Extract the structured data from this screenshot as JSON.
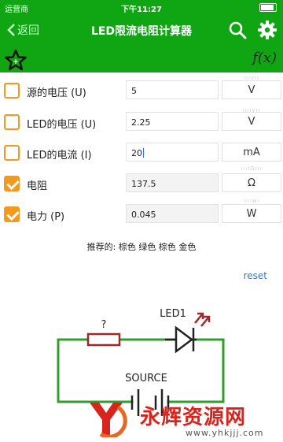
{
  "status_bar": {
    "carrier": "运营商",
    "time": "下午11:27"
  },
  "nav": {
    "back_label": "返回",
    "title": "LED限流电阻计算器"
  },
  "toolbar": {
    "fx_label": "f(x)"
  },
  "rows": [
    {
      "label": "源的电压 (U)",
      "value": "5",
      "unit": "V",
      "checked": false,
      "readonly": false
    },
    {
      "label": "LED的电压 (U)",
      "value": "2.25",
      "unit": "V",
      "checked": false,
      "readonly": false
    },
    {
      "label": "LED的电流 (I)",
      "value": "20",
      "unit": "mA",
      "checked": false,
      "readonly": false
    },
    {
      "label": "电阻",
      "value": "137.5",
      "unit": "Ω",
      "checked": true,
      "readonly": true
    },
    {
      "label": "电力 (P)",
      "value": "0.045",
      "unit": "W",
      "checked": true,
      "readonly": true
    }
  ],
  "recommend": "推荐的: 棕色 绿色 棕色 金色",
  "reset_label": "reset",
  "circuit": {
    "resistor_label": "?",
    "led_label": "LED1",
    "source_label": "SOURCE"
  },
  "colors": {
    "brand_green": "#0fa513",
    "checkbox_orange": "#f39a1e",
    "link_blue": "#2a7ad6",
    "wire_green": "#2ea02a",
    "resistor_red": "#a0282a"
  },
  "watermark": {
    "text": "永辉资源网",
    "url": "www.yhkjjj.com"
  }
}
